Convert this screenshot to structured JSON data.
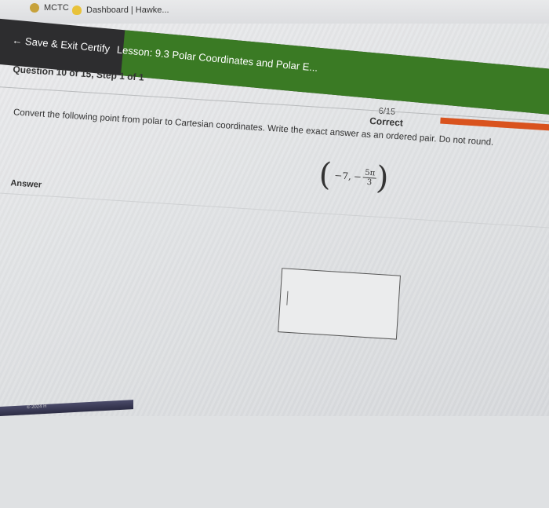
{
  "bookmarks": {
    "item1": "MCTC",
    "item2": "Dashboard | Hawke..."
  },
  "header": {
    "back_label": "Save & Exit Certify",
    "lesson_title": "Lesson: 9.3 Polar Coordinates and Polar E..."
  },
  "question": {
    "info": "Question 10 of 15, Step 1 of 1",
    "score_fraction": "6/15",
    "score_status": "Correct",
    "progress_fraction": 0.4,
    "prompt": "Convert the following point from polar to Cartesian coordinates. Write the exact answer as an ordered pair. Do not round.",
    "point": {
      "r": "−7,",
      "theta_sign": "−",
      "theta_num": "5π",
      "theta_den": "3"
    },
    "answer_label": "Answer",
    "answer_value": ""
  },
  "footer": {
    "text": "© 2024 H"
  },
  "colors": {
    "topbar": "#2d2d2f",
    "lesson_bar": "#3a7a24",
    "progress": "#d9531e"
  }
}
